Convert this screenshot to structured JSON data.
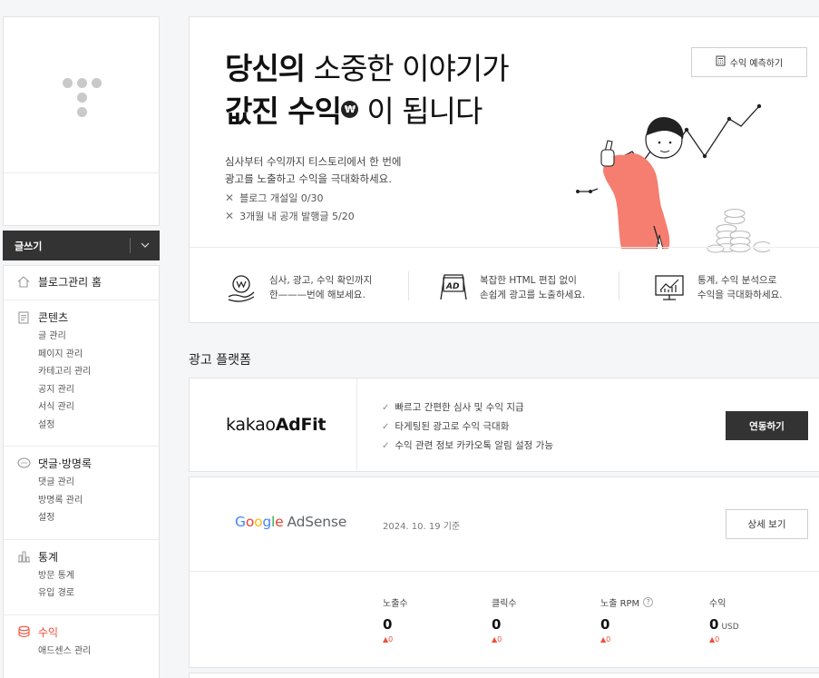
{
  "sidebar": {
    "write_label": "글쓰기",
    "groups": [
      {
        "icon": "home-icon",
        "label": "블로그관리 홈",
        "subs": []
      },
      {
        "icon": "document-icon",
        "label": "콘텐츠",
        "subs": [
          "글 관리",
          "페이지 관리",
          "카테고리 관리",
          "공지 관리",
          "서식 관리",
          "설정"
        ]
      },
      {
        "icon": "speech-bubble-icon",
        "label": "댓글·방명록",
        "subs": [
          "댓글 관리",
          "방명록 관리",
          "설정"
        ]
      },
      {
        "icon": "bar-chart-icon",
        "label": "통계",
        "subs": [
          "방문 통계",
          "유입 경로"
        ]
      },
      {
        "icon": "coin-icon",
        "label": "수익",
        "subs": [
          "애드센스 관리"
        ],
        "active": true
      }
    ]
  },
  "hero": {
    "title_line1_bold": "당신의",
    "title_line1_rest": " 소중한 이야기가",
    "title_line2_bold": "값진 수익",
    "won_symbol": "₩",
    "title_line2_rest": " 이 됩니다",
    "desc_line1": "심사부터 수익까지 티스토리에서 한 번에",
    "desc_line2": "광고를 노출하고 수익을 극대화하세요.",
    "conditions": [
      "블로그 개설일 0/30",
      "3개월 내 공개 발행글 5/20"
    ],
    "predict_button": "수익 예측하기",
    "features": [
      {
        "line1": "심사, 광고, 수익 확인까지",
        "line2": "한———번에 해보세요."
      },
      {
        "line1": "복잡한 HTML 편집 없이",
        "line2": "손쉽게 광고를 노출하세요."
      },
      {
        "line1": "통계, 수익 분석으로",
        "line2": "수익을 극대화하세요."
      }
    ]
  },
  "ad_platform": {
    "title": "광고 플랫폼",
    "adfit": {
      "logo_light": "kakao",
      "logo_bold": "AdFit",
      "features": [
        "빠르고 간편한 심사 및 수익 지급",
        "타게팅된 광고로 수익 극대화",
        "수익 관련 정보 카카오톡 알림 설정 가능"
      ],
      "button": "연동하기"
    },
    "adsense": {
      "logo_letters": [
        "G",
        "o",
        "o",
        "g",
        "l",
        "e"
      ],
      "logo_word": "AdSense",
      "date_note": "2024. 10. 19 기준",
      "button": "상세 보기",
      "stats": [
        {
          "label": "노출수",
          "value": "0",
          "unit": "",
          "delta": "▲0",
          "help": ""
        },
        {
          "label": "클릭수",
          "value": "0",
          "unit": "",
          "delta": "▲0",
          "help": ""
        },
        {
          "label": "노출 RPM",
          "value": "0",
          "unit": "",
          "delta": "▲0",
          "help": "?"
        },
        {
          "label": "수익",
          "value": "0",
          "unit": "USD",
          "delta": "▲0",
          "help": ""
        }
      ]
    }
  }
}
